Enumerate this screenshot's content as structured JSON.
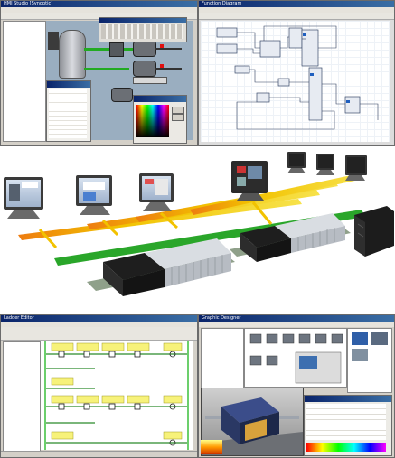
{
  "top_left": {
    "title": "HMI Studio [Synoptic]"
  },
  "top_right": {
    "title": "Function Diagram"
  },
  "bottom_left": {
    "title": "Ladder Editor"
  },
  "bottom_right": {
    "title": "Graphic Designer"
  },
  "colors": {
    "tank": "#b9bcc2",
    "pipe_green": "#22aa22",
    "rail_green": "#2aa62a",
    "rail_yellow": "#f2c200",
    "rail_orange": "#ee7c10",
    "rung_yellow": "#f7f27a",
    "ladder_green": "#6ccf6c"
  }
}
